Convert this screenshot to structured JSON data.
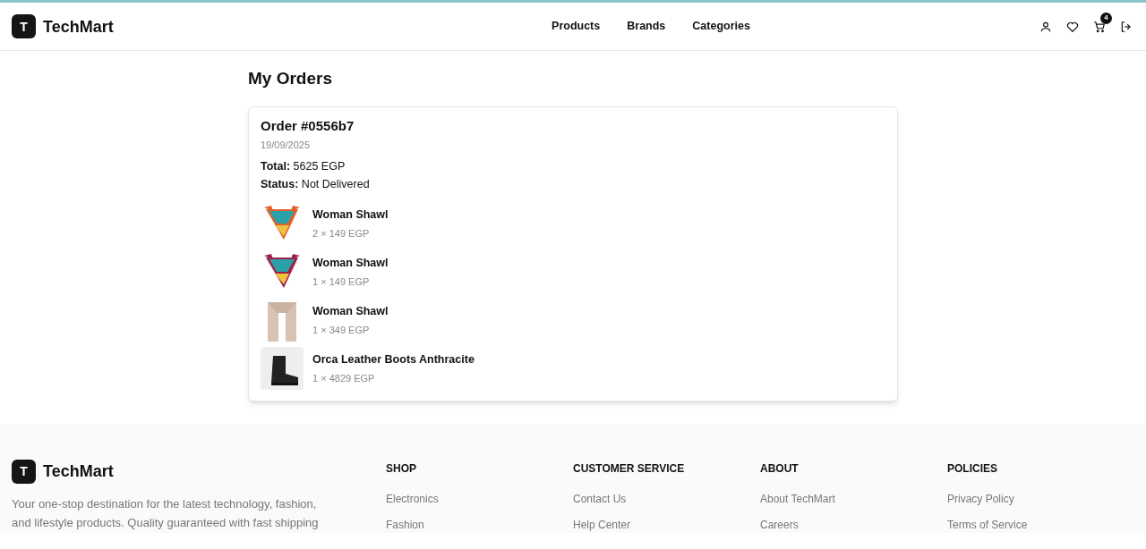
{
  "header": {
    "logo_letter": "T",
    "brand": "TechMart",
    "nav": [
      {
        "label": "Products"
      },
      {
        "label": "Brands"
      },
      {
        "label": "Categories"
      }
    ],
    "cart_count": "4"
  },
  "page_title": "My Orders",
  "orders": [
    {
      "title": "Order #0556b7",
      "date": "19/09/2025",
      "total_label": "Total:",
      "total": "5625 EGP",
      "status_label": "Status:",
      "status": "Not Delivered",
      "items": [
        {
          "name": "Woman Shawl",
          "qty": "2 × 149 EGP"
        },
        {
          "name": "Woman Shawl",
          "qty": "1 × 149 EGP"
        },
        {
          "name": "Woman Shawl",
          "qty": "1 × 349 EGP"
        },
        {
          "name": "Orca Leather Boots Anthracite",
          "qty": "1 × 4829 EGP"
        }
      ]
    }
  ],
  "footer": {
    "logo_letter": "T",
    "brand": "TechMart",
    "description": "Your one-stop destination for the latest technology, fashion, and lifestyle products. Quality guaranteed with fast shipping",
    "columns": [
      {
        "heading": "SHOP",
        "links": [
          "Electronics",
          "Fashion"
        ]
      },
      {
        "heading": "CUSTOMER SERVICE",
        "links": [
          "Contact Us",
          "Help Center"
        ]
      },
      {
        "heading": "ABOUT",
        "links": [
          "About TechMart",
          "Careers"
        ]
      },
      {
        "heading": "POLICIES",
        "links": [
          "Privacy Policy",
          "Terms of Service"
        ]
      }
    ]
  }
}
